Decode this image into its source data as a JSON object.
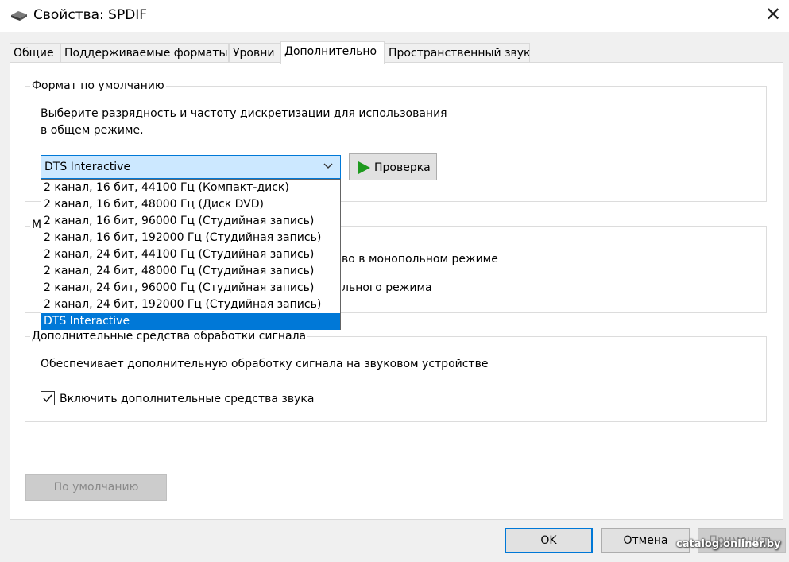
{
  "window": {
    "title": "Свойства: SPDIF"
  },
  "tabs": [
    {
      "label": "Общие",
      "active": false
    },
    {
      "label": "Поддерживаемые форматы",
      "active": false
    },
    {
      "label": "Уровни",
      "active": false
    },
    {
      "label": "Дополнительно",
      "active": true
    },
    {
      "label": "Пространственный звук",
      "active": false
    }
  ],
  "default_format": {
    "legend": "Формат по умолчанию",
    "desc_line1": "Выберите разрядность и частоту дискретизации для использования",
    "desc_line2": "в общем режиме.",
    "selected": "DTS Interactive",
    "test_button": "Проверка",
    "options": [
      "2 канал, 16 бит, 44100 Гц (Компакт-диск)",
      "2 канал, 16 бит, 48000 Гц (Диск DVD)",
      "2 канал, 16 бит, 96000 Гц (Студийная запись)",
      "2 канал, 16 бит, 192000 Гц (Студийная запись)",
      "2 канал, 24 бит, 44100 Гц (Студийная запись)",
      "2 канал, 24 бит, 48000 Гц (Студийная запись)",
      "2 канал, 24 бит, 96000 Гц (Студийная запись)",
      "2 канал, 24 бит, 192000 Гц (Студийная запись)",
      "DTS Interactive"
    ]
  },
  "exclusive_mode": {
    "legend_partial": "М",
    "line1_partial": "во в монопольном режиме",
    "line2_partial": "льного режима"
  },
  "signal_enhancements": {
    "legend": "Дополнительные средства обработки сигнала",
    "desc": "Обеспечивает дополнительную обработку сигнала на звуковом устройстве",
    "checkbox_label": "Включить дополнительные средства звука",
    "checked": true
  },
  "buttons": {
    "restore_defaults": "По умолчанию",
    "ok": "OK",
    "cancel": "Отмена",
    "apply": "Применить"
  },
  "watermark": "catalog.onliner.by",
  "colors": {
    "accent": "#0078d7",
    "select_bg": "#cce8ff",
    "play_green": "#1e9a1e"
  }
}
